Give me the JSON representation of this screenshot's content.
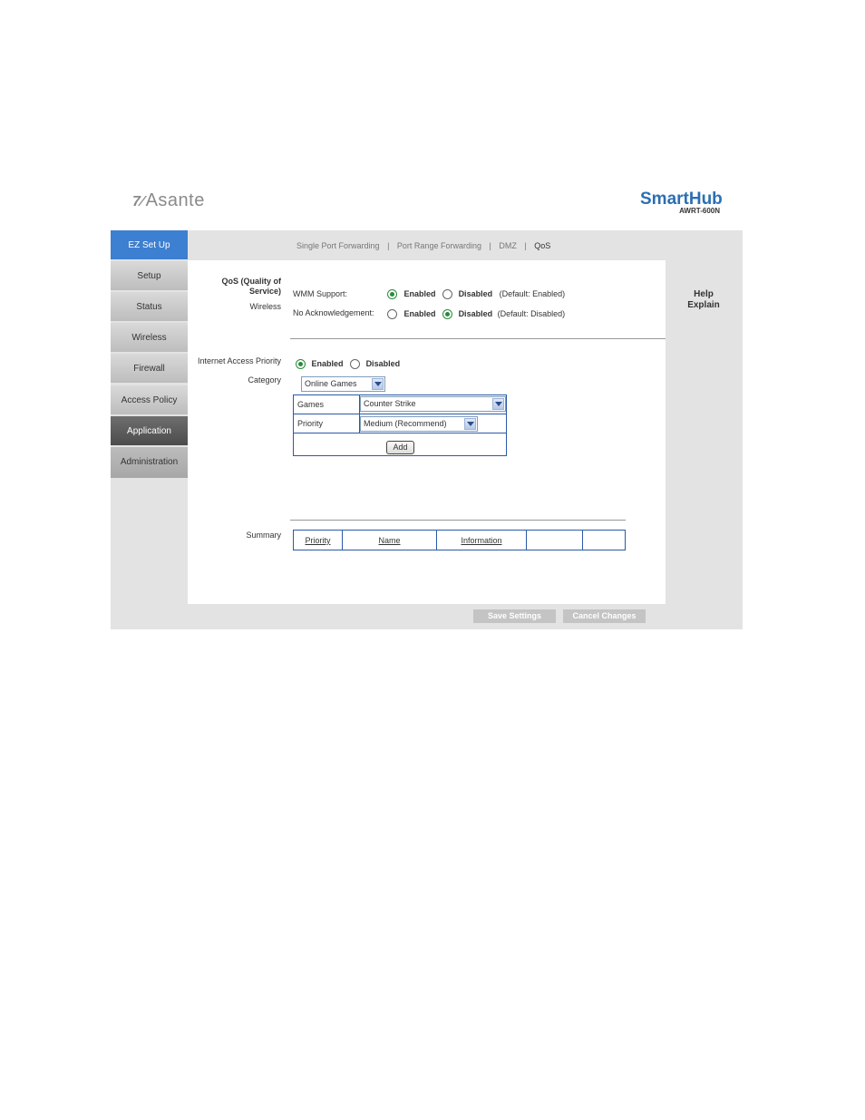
{
  "header": {
    "logo_text": "Asante",
    "brand_name": "SmartHub",
    "brand_model": "AWRT-600N"
  },
  "topnav": {
    "items": [
      "Single Port Forwarding",
      "Port Range Forwarding",
      "DMZ",
      "QoS"
    ],
    "separator": "|",
    "active": "QoS"
  },
  "sidebar": {
    "items": [
      {
        "label": "EZ Set Up"
      },
      {
        "label": "Setup"
      },
      {
        "label": "Status"
      },
      {
        "label": "Wireless"
      },
      {
        "label": "Firewall"
      },
      {
        "label": "Access Policy"
      },
      {
        "label": "Application"
      },
      {
        "label": "Administration"
      }
    ]
  },
  "qos": {
    "section_title": "QoS (Quality of Service)",
    "section_title_line1": "QoS (Quality of",
    "section_title_line2": "Service)",
    "wireless_label": "Wireless",
    "wmm_label": "WMM Support:",
    "wmm_enabled": "Enabled",
    "wmm_disabled": "Disabled",
    "wmm_default": "(Default: Enabled)",
    "wmm_value": "Enabled",
    "noack_label": "No Acknowledgement:",
    "noack_enabled": "Enabled",
    "noack_disabled": "Disabled",
    "noack_default": "(Default: Disabled)",
    "noack_value": "Disabled"
  },
  "internet_priority": {
    "label": "Internet Access Priority",
    "enabled": "Enabled",
    "disabled": "Disabled",
    "value": "Enabled",
    "category_label": "Category",
    "category_value": "Online Games",
    "games_label": "Games",
    "games_value": "Counter Strike",
    "priority_label": "Priority",
    "priority_value": "Medium (Recommend)",
    "add_button": "Add"
  },
  "summary": {
    "label": "Summary",
    "columns": [
      "Priority",
      "Name",
      "Information",
      "",
      ""
    ]
  },
  "help": {
    "line1": "Help",
    "line2": "Explain"
  },
  "actions": {
    "save": "Save Settings",
    "cancel": "Cancel Changes"
  }
}
